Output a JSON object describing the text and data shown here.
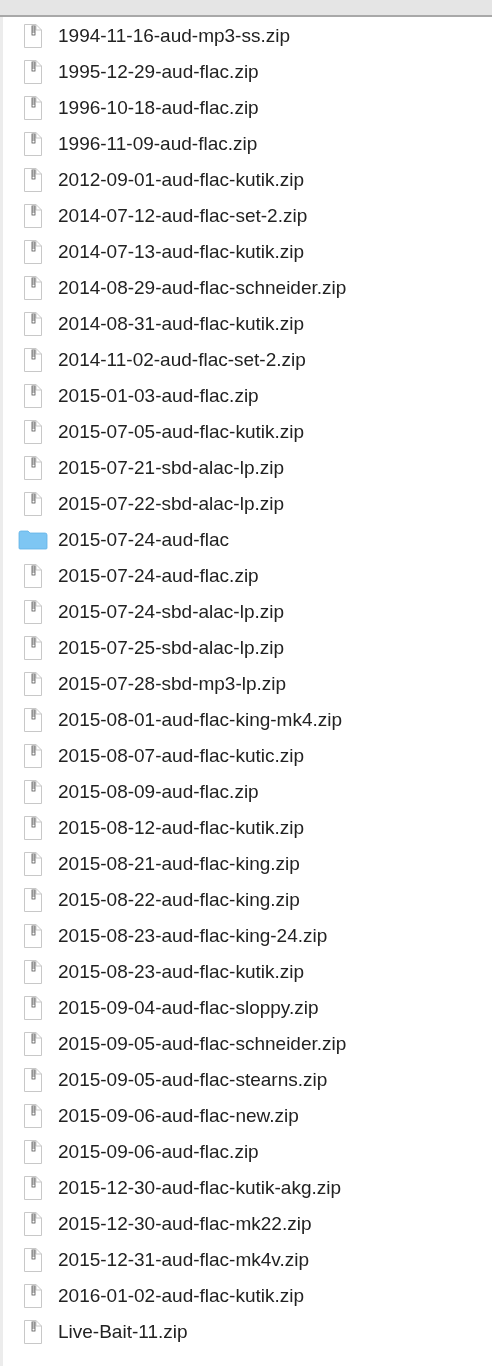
{
  "files": [
    {
      "name": "1994-11-16-aud-mp3-ss.zip",
      "kind": "zip"
    },
    {
      "name": "1995-12-29-aud-flac.zip",
      "kind": "zip"
    },
    {
      "name": "1996-10-18-aud-flac.zip",
      "kind": "zip"
    },
    {
      "name": "1996-11-09-aud-flac.zip",
      "kind": "zip"
    },
    {
      "name": "2012-09-01-aud-flac-kutik.zip",
      "kind": "zip"
    },
    {
      "name": "2014-07-12-aud-flac-set-2.zip",
      "kind": "zip"
    },
    {
      "name": "2014-07-13-aud-flac-kutik.zip",
      "kind": "zip"
    },
    {
      "name": "2014-08-29-aud-flac-schneider.zip",
      "kind": "zip"
    },
    {
      "name": "2014-08-31-aud-flac-kutik.zip",
      "kind": "zip"
    },
    {
      "name": "2014-11-02-aud-flac-set-2.zip",
      "kind": "zip"
    },
    {
      "name": "2015-01-03-aud-flac.zip",
      "kind": "zip"
    },
    {
      "name": "2015-07-05-aud-flac-kutik.zip",
      "kind": "zip"
    },
    {
      "name": "2015-07-21-sbd-alac-lp.zip",
      "kind": "zip"
    },
    {
      "name": "2015-07-22-sbd-alac-lp.zip",
      "kind": "zip"
    },
    {
      "name": "2015-07-24-aud-flac",
      "kind": "folder"
    },
    {
      "name": "2015-07-24-aud-flac.zip",
      "kind": "zip"
    },
    {
      "name": "2015-07-24-sbd-alac-lp.zip",
      "kind": "zip"
    },
    {
      "name": "2015-07-25-sbd-alac-lp.zip",
      "kind": "zip"
    },
    {
      "name": "2015-07-28-sbd-mp3-lp.zip",
      "kind": "zip"
    },
    {
      "name": "2015-08-01-aud-flac-king-mk4.zip",
      "kind": "zip"
    },
    {
      "name": "2015-08-07-aud-flac-kutic.zip",
      "kind": "zip"
    },
    {
      "name": "2015-08-09-aud-flac.zip",
      "kind": "zip"
    },
    {
      "name": "2015-08-12-aud-flac-kutik.zip",
      "kind": "zip"
    },
    {
      "name": "2015-08-21-aud-flac-king.zip",
      "kind": "zip"
    },
    {
      "name": "2015-08-22-aud-flac-king.zip",
      "kind": "zip"
    },
    {
      "name": "2015-08-23-aud-flac-king-24.zip",
      "kind": "zip"
    },
    {
      "name": "2015-08-23-aud-flac-kutik.zip",
      "kind": "zip"
    },
    {
      "name": "2015-09-04-aud-flac-sloppy.zip",
      "kind": "zip"
    },
    {
      "name": "2015-09-05-aud-flac-schneider.zip",
      "kind": "zip"
    },
    {
      "name": "2015-09-05-aud-flac-stearns.zip",
      "kind": "zip"
    },
    {
      "name": "2015-09-06-aud-flac-new.zip",
      "kind": "zip"
    },
    {
      "name": "2015-09-06-aud-flac.zip",
      "kind": "zip"
    },
    {
      "name": "2015-12-30-aud-flac-kutik-akg.zip",
      "kind": "zip"
    },
    {
      "name": "2015-12-30-aud-flac-mk22.zip",
      "kind": "zip"
    },
    {
      "name": "2015-12-31-aud-flac-mk4v.zip",
      "kind": "zip"
    },
    {
      "name": "2016-01-02-aud-flac-kutik.zip",
      "kind": "zip"
    },
    {
      "name": "Live-Bait-11.zip",
      "kind": "zip"
    }
  ]
}
